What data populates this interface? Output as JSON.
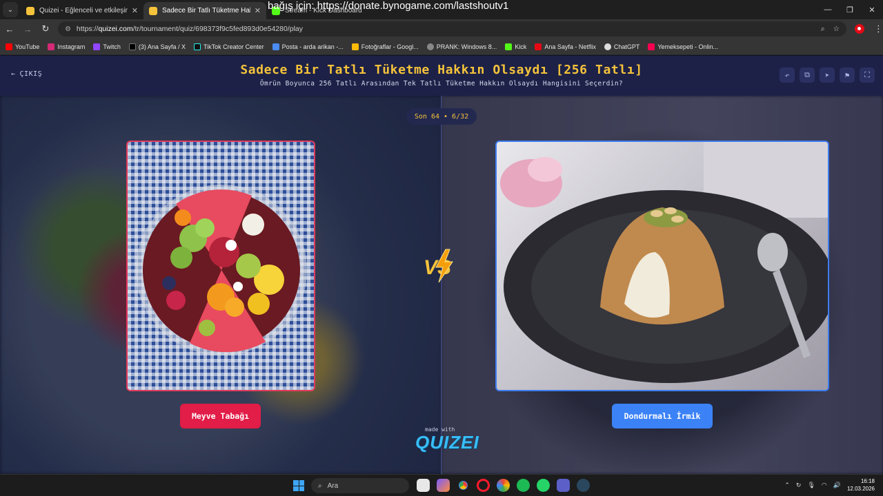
{
  "browser": {
    "tabs": [
      {
        "title": "Quizei - Eğlenceli ve etkileşimli",
        "active": false
      },
      {
        "title": "Sadece Bir Tatlı Tüketme Hakkın",
        "active": true
      },
      {
        "title": "Stream - Kick Dashboard",
        "active": false
      }
    ],
    "donate_text": "bağış için: https://donate.bynogame.com/lastshoutv1",
    "url_prefix": "https://",
    "url_host": "quizei.com",
    "url_path": "/tr/tournament/quiz/698373f9c5fed893d0e54280/play",
    "bookmarks": [
      "YouTube",
      "Instagram",
      "Twitch",
      "(3) Ana Sayfa / X",
      "TikTok Creator Center",
      "Posta - arda arikan -...",
      "Fotoğraflar - Googl...",
      "PRANK: Windows 8...",
      "Kick",
      "Ana Sayfa - Netflix",
      "ChatGPT",
      "Yemeksepeti - Onlin..."
    ]
  },
  "header": {
    "exit_label": "ÇIKIŞ",
    "title": "Sadece Bir Tatlı Tüketme Hakkın Olsaydı [256 Tatlı]",
    "subtitle": "Ömrün Boyunca 256 Tatlı Arasından Tek Tatlı Tüketme Hakkın Olsaydı Hangisini Seçerdin?"
  },
  "round": {
    "label": "Son 64 • 6/32"
  },
  "left_choice": {
    "label": "Meyve Tabağı",
    "accent": "#e11d48"
  },
  "right_choice": {
    "label": "Dondurmalı İrmik",
    "accent": "#3b82f6"
  },
  "branding": {
    "made_with": "made with",
    "name": "QUIZEI"
  },
  "taskbar": {
    "search_placeholder": "Ara",
    "time": "16:18",
    "date": "12.03.2026"
  }
}
